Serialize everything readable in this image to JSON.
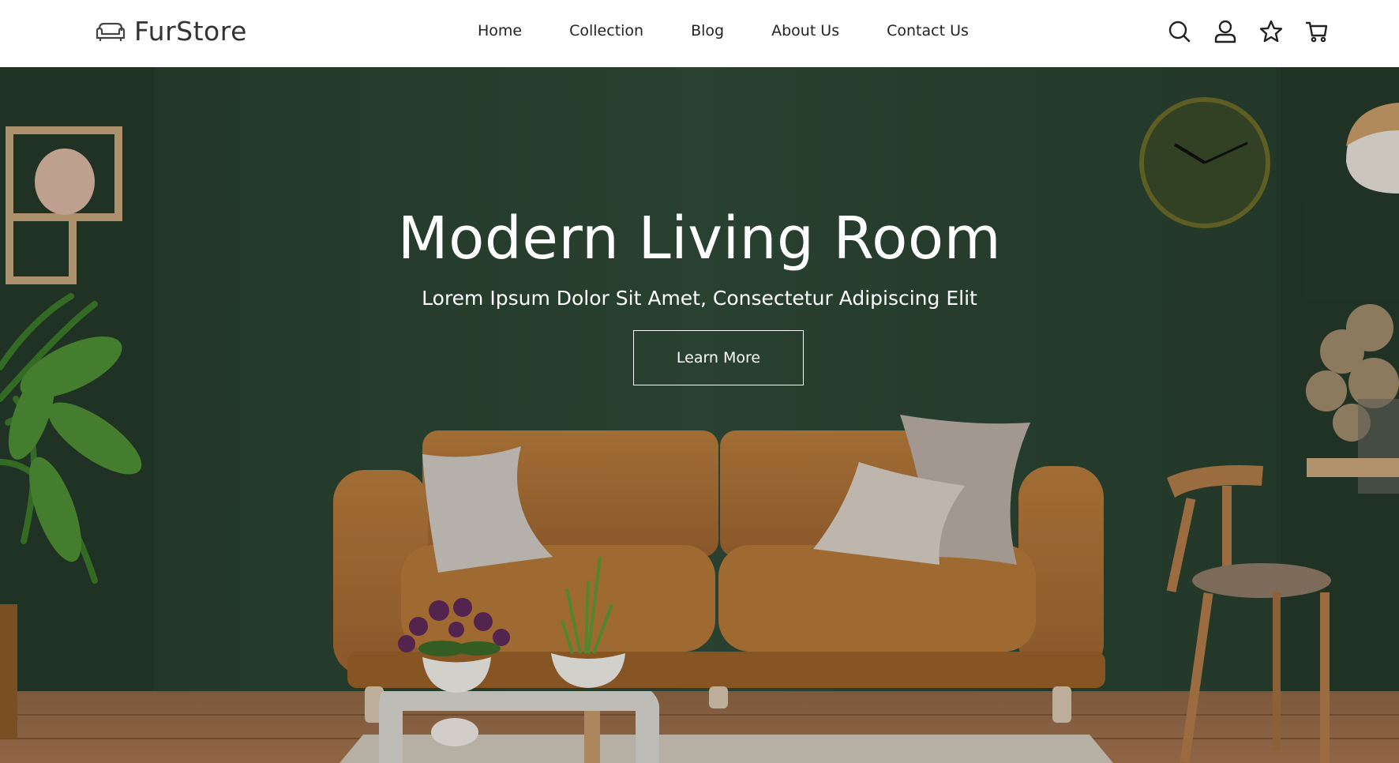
{
  "brand": {
    "name": "FurStore",
    "logo_icon": "sofa-icon"
  },
  "nav": {
    "items": [
      {
        "label": "Home"
      },
      {
        "label": "Collection"
      },
      {
        "label": "Blog"
      },
      {
        "label": "About Us"
      },
      {
        "label": "Contact Us"
      }
    ]
  },
  "header_icons": [
    "search-icon",
    "user-icon",
    "star-icon",
    "cart-icon"
  ],
  "hero": {
    "title": "Modern Living Room",
    "subtitle": "Lorem Ipsum Dolor Sit Amet, Consectetur Adipiscing Elit",
    "button_label": "Learn More"
  },
  "colors": {
    "header_bg": "#ffffff",
    "wall_green": "#2f4a37",
    "sofa_tan": "#b0743a",
    "floor_wood": "#a47350",
    "text_dark": "#222222"
  }
}
